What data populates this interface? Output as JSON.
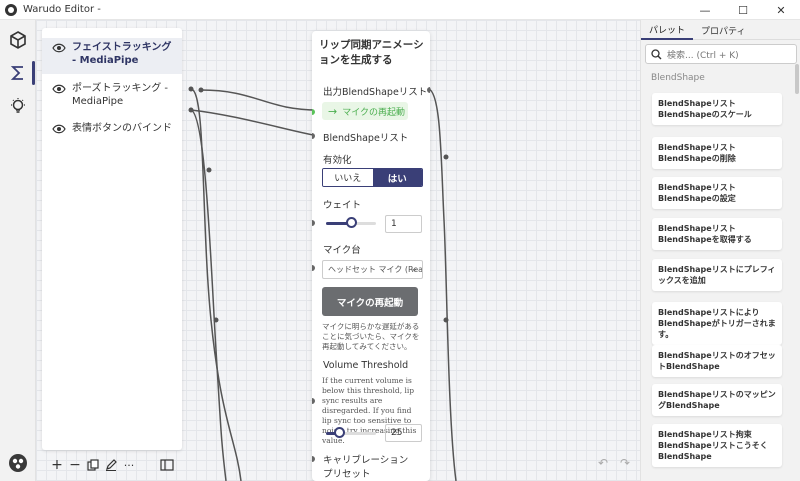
{
  "window": {
    "title": "Warudo Editor -",
    "buttons": {
      "minimize": "—",
      "maximize": "☐",
      "close": "✕"
    }
  },
  "rail": {
    "icons": [
      "cube-icon",
      "sigma-icon",
      "lightbulb-icon"
    ],
    "active": "sigma-icon",
    "bottom_icon": "community-icon"
  },
  "list": {
    "items": [
      {
        "label": "フェイストラッキング - MediaPipe",
        "selected": true
      },
      {
        "label": "ポーズトラッキング - MediaPipe",
        "selected": false
      },
      {
        "label": "表情ボタンのバインド",
        "selected": false
      }
    ],
    "toolbar": {
      "add": "+",
      "remove": "−",
      "more": "···"
    }
  },
  "node": {
    "title": "リップ同期アニメーションを生成する",
    "output_label": "出力BlendShapeリスト",
    "output_pill": "マイクの再起動",
    "blendshape_label": "BlendShapeリスト",
    "enabled_label": "有効化",
    "toggle_no": "いいえ",
    "toggle_yes": "はい",
    "weight_label": "ウェイト",
    "weight_value": "1",
    "weight_fraction": 0.5,
    "mic_label": "マイク台",
    "mic_value": "ヘッドセット マイク (Realtek ...",
    "mic_button": "マイクの再起動",
    "mic_hint": "マイクに明らかな遅延があることに気づいたら、マイクを再起動してみてください。",
    "volume_label": "Volume Threshold",
    "volume_desc": "If the current volume is below this threshold, lip sync results are disregarded. If you find lip sync too sensitive to noise, try increasing this value.",
    "volume_value": "25",
    "volume_fraction": 0.25,
    "calibration_label": "キャリブレーション",
    "preset_label": "プリセット"
  },
  "palette": {
    "tabs": [
      "パレット",
      "プロパティ"
    ],
    "active_tab": 0,
    "search_placeholder": "検索... (Ctrl + K)",
    "category": "BlendShape",
    "items": [
      "BlendShapeリストBlendShapeのスケール",
      "BlendShapeリストBlendShapeの削除",
      "BlendShapeリストBlendShapeの設定",
      "BlendShapeリストBlendShapeを取得する",
      "BlendShapeリストにプレフィックスを追加",
      "BlendShapeリストによりBlendShapeがトリガーされます。",
      "BlendShapeリストのオフセットBlendShape",
      "BlendShapeリストのマッピングBlendShape",
      "BlendShapeリスト拘束BlendShapeリストこうそくBlendShape"
    ]
  },
  "history": {
    "undo": "↶",
    "redo": "↷"
  },
  "colors": {
    "accent": "#3a3f77",
    "green": "#5ac35a",
    "button_gray": "#6b6d70"
  }
}
